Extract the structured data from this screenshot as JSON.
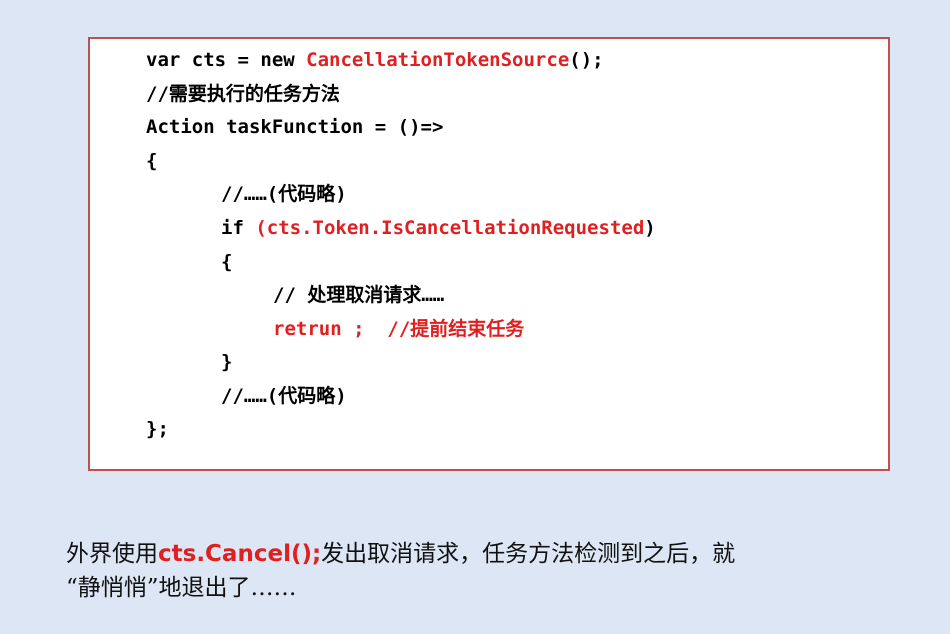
{
  "code": {
    "line1_a": "var cts = new ",
    "line1_b": "CancellationTokenSource",
    "line1_c": "();",
    "line2": "//需要执行的任务方法",
    "line3": "Action taskFunction = ()=>",
    "line4": "{",
    "line5": "//……(代码略)",
    "line6_a": "if ",
    "line6_b": "(cts.Token.IsCancellationRequested",
    "line6_c": ")",
    "line7": "{",
    "line8": "// 处理取消请求……",
    "line9": "retrun ;  //提前结束任务",
    "line10": "}",
    "line11": "//……(代码略)",
    "line12": "};"
  },
  "caption": {
    "line1_a": "外界使用",
    "line1_b": "cts.Cancel();",
    "line1_c": "发出取消请求，任务方法检测到之后，就",
    "line2": "“静悄悄”地退出了……"
  }
}
